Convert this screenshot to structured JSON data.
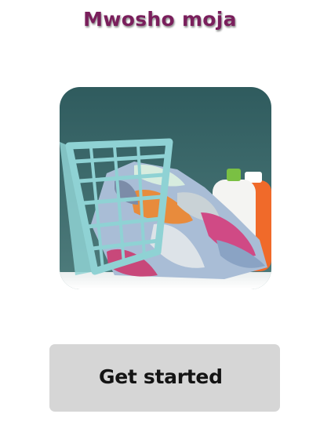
{
  "header": {
    "title": "Mwosho moja"
  },
  "hero": {
    "image": "laundry-basket-with-clothes"
  },
  "actions": {
    "get_started_label": "Get started"
  },
  "colors": {
    "title": "#7a1f5c",
    "button_bg": "#d6d6d6",
    "hero_backdrop": "#3e6a6c"
  }
}
